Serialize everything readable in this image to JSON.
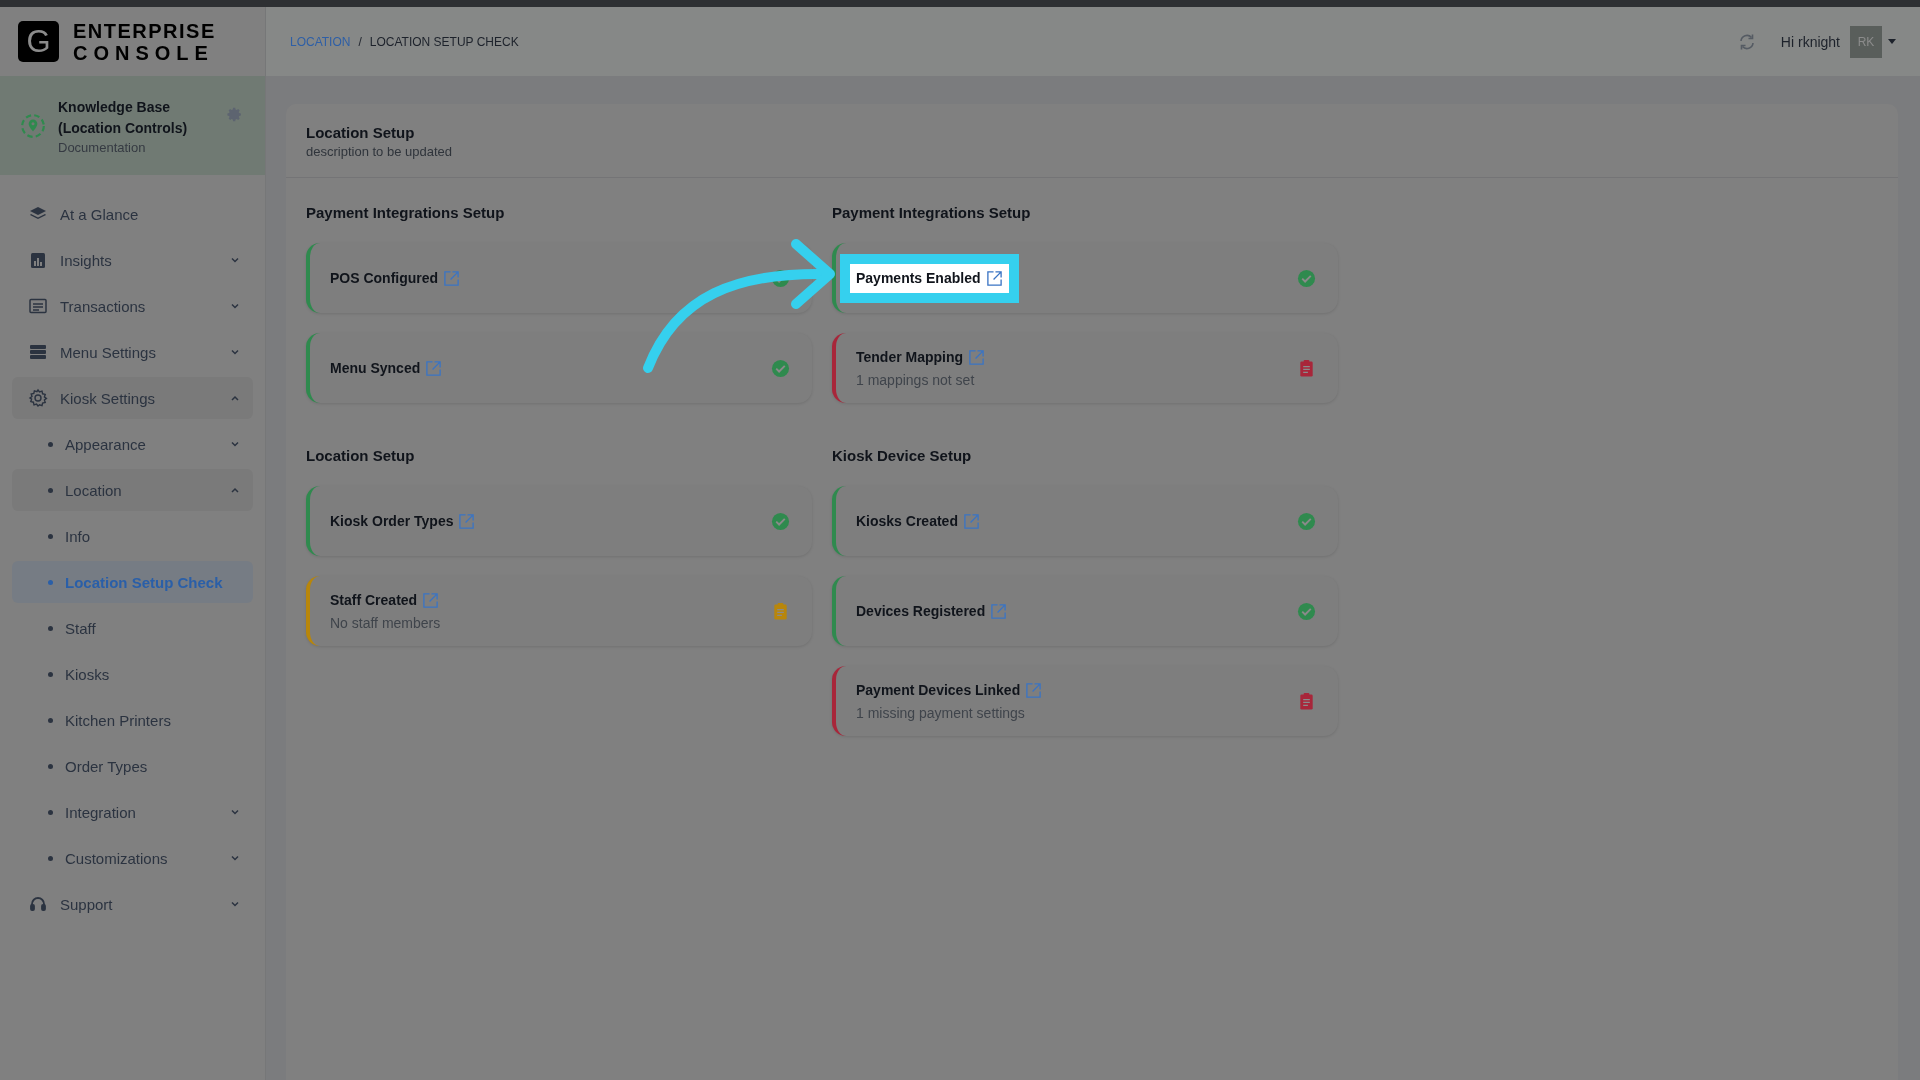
{
  "app": {
    "logo_letter": "G",
    "name_lines": [
      "ENTERPRISE",
      "CONSOLE"
    ]
  },
  "breadcrumb": {
    "items": [
      {
        "label": "LOCATION",
        "link": true
      },
      {
        "label": "LOCATION SETUP CHECK",
        "link": false
      }
    ],
    "separator": "/"
  },
  "user": {
    "greeting": "Hi rknight",
    "initials": "RK"
  },
  "workspace": {
    "title": "Knowledge Base (Location Controls)",
    "subtitle": "Documentation"
  },
  "sidebar": {
    "items": [
      {
        "label": "At a Glance",
        "expandable": false,
        "selected": false
      },
      {
        "label": "Insights",
        "expandable": true,
        "expanded": false,
        "selected": false
      },
      {
        "label": "Transactions",
        "expandable": true,
        "expanded": false,
        "selected": false
      },
      {
        "label": "Menu Settings",
        "expandable": true,
        "expanded": false,
        "selected": false
      },
      {
        "label": "Kiosk Settings",
        "expandable": true,
        "expanded": true,
        "selected": false,
        "children": [
          {
            "label": "Appearance",
            "expandable": true,
            "expanded": false,
            "selected": false
          },
          {
            "label": "Location",
            "expandable": true,
            "expanded": true,
            "selected": false
          },
          {
            "label": "Info",
            "expandable": false,
            "selected": false
          },
          {
            "label": "Location Setup Check",
            "expandable": false,
            "selected": true
          },
          {
            "label": "Staff",
            "expandable": false,
            "selected": false
          },
          {
            "label": "Kiosks",
            "expandable": false,
            "selected": false
          },
          {
            "label": "Kitchen Printers",
            "expandable": false,
            "selected": false
          },
          {
            "label": "Order Types",
            "expandable": false,
            "selected": false
          },
          {
            "label": "Integration",
            "expandable": true,
            "expanded": false,
            "selected": false
          },
          {
            "label": "Customizations",
            "expandable": true,
            "expanded": false,
            "selected": false
          }
        ]
      },
      {
        "label": "Support",
        "expandable": true,
        "expanded": false,
        "selected": false
      }
    ]
  },
  "panel": {
    "title": "Location Setup",
    "description": "description to be updated",
    "columns": [
      [
        {
          "title": "Payment Integrations Setup",
          "checks": [
            {
              "label": "POS Configured",
              "kind": "ok",
              "highlighted": false
            },
            {
              "label": "Menu Synced",
              "kind": "ok",
              "highlighted": false
            }
          ]
        },
        {
          "title": "Location Setup",
          "checks": [
            {
              "label": "Kiosk Order Types",
              "kind": "ok",
              "highlighted": false
            },
            {
              "label": "Staff Created",
              "kind": "warning",
              "note": "No staff members",
              "highlighted": false
            }
          ]
        }
      ],
      [
        {
          "title": "Payment Integrations Setup",
          "checks": [
            {
              "label": "Payments Enabled",
              "kind": "ok",
              "highlighted": true
            },
            {
              "label": "Tender Mapping",
              "kind": "error",
              "note": "1 mappings not set",
              "highlighted": false
            }
          ]
        },
        {
          "title": "Kiosk Device Setup",
          "checks": [
            {
              "label": "Kiosks Created",
              "kind": "ok",
              "highlighted": false
            },
            {
              "label": "Devices Registered",
              "kind": "ok",
              "highlighted": false
            },
            {
              "label": "Payment Devices Linked",
              "kind": "error",
              "note": "1 missing payment settings",
              "highlighted": false
            }
          ]
        }
      ]
    ]
  }
}
